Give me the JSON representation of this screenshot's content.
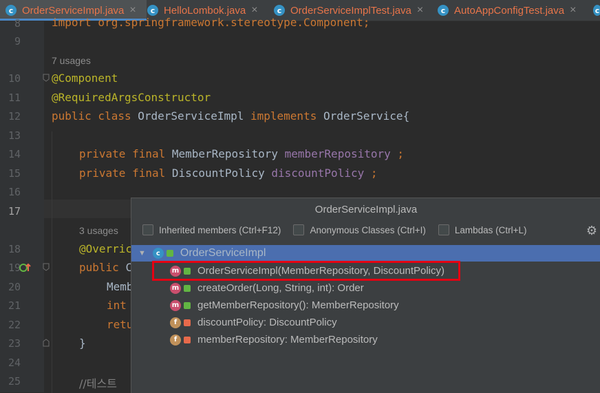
{
  "tabs": [
    {
      "label": "OrderServiceImpl.java",
      "active": true
    },
    {
      "label": "HelloLombok.java"
    },
    {
      "label": "OrderServiceImplTest.java"
    },
    {
      "label": "AutoAppConfigTest.java"
    }
  ],
  "line_numbers": [
    "8",
    "9",
    "10",
    "11",
    "12",
    "13",
    "14",
    "15",
    "16",
    "17",
    "18",
    "19",
    "20",
    "21",
    "22",
    "23",
    "24",
    "25"
  ],
  "code": {
    "l8": "import org.springframework.stereotype.Component;",
    "hint_usages_7": "7 usages",
    "l10": "@Component",
    "l11": "@RequiredArgsConstructor",
    "l12_kw1": "public class ",
    "l12_id1": "OrderServiceImpl ",
    "l12_kw2": "implements ",
    "l12_id2": "OrderService",
    "l12_brace": "{",
    "l14_kw": "private final ",
    "l14_type": "MemberRepository ",
    "l14_field": "memberRepository",
    "l14_semi": " ;",
    "l15_kw": "private final ",
    "l15_type": "DiscountPolicy ",
    "l15_field": "discountPolicy",
    "l15_semi": " ;",
    "hint_usages_3": "3 usages",
    "l18": "@Overric",
    "l19_kw": "public ",
    "l19_id": "C",
    "l20": "Memb",
    "l21": "int ",
    "l22": "retu",
    "l23": "}",
    "l25": "//테스트"
  },
  "popup": {
    "title": "OrderServiceImpl.java",
    "filters": [
      {
        "label": "Inherited members (Ctrl+F12)",
        "checked": false
      },
      {
        "label": "Anonymous Classes (Ctrl+I)",
        "checked": false
      },
      {
        "label": "Lambdas (Ctrl+L)",
        "checked": false
      }
    ],
    "root": {
      "label": "OrderServiceImpl",
      "icon": "class-icon"
    },
    "members": [
      {
        "label": "OrderServiceImpl(MemberRepository, DiscountPolicy)",
        "kind": "m",
        "visibility": "public",
        "highlighted": true
      },
      {
        "label": "createOrder(Long, String, int): Order",
        "kind": "m",
        "visibility": "public"
      },
      {
        "label": "getMemberRepository(): MemberRepository",
        "kind": "m",
        "visibility": "public"
      },
      {
        "label": "discountPolicy: DiscountPolicy",
        "kind": "f",
        "visibility": "private"
      },
      {
        "label": "memberRepository: MemberRepository",
        "kind": "f",
        "visibility": "private"
      }
    ]
  },
  "colors": {
    "keyword": "#cc7832",
    "annotation": "#bbb529",
    "field": "#9876aa",
    "selection": "#4b6eaf",
    "highlight_box": "#e60012"
  }
}
